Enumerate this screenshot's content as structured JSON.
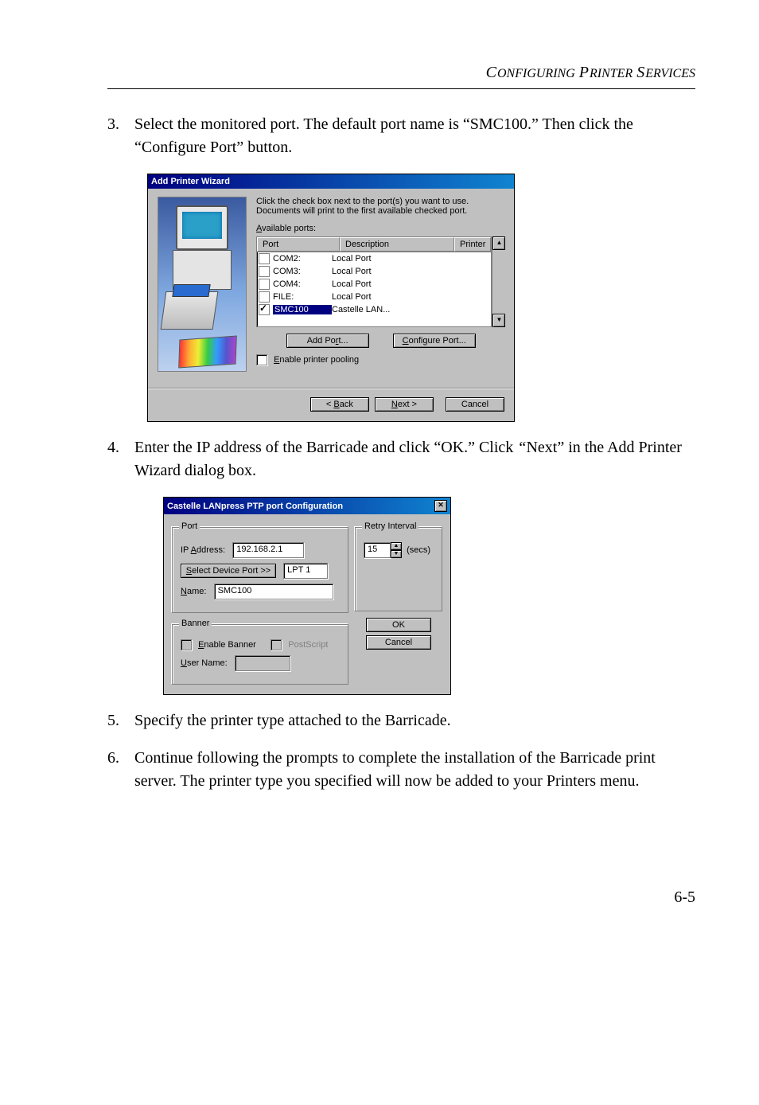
{
  "header": "Configuring Printer Services",
  "steps": {
    "s3": {
      "num": "3.",
      "text": "Select the monitored port. The default port name is “SMC100.” Then click the “Configure Port” button."
    },
    "s4": {
      "num": "4.",
      "text": "Enter the IP address of the Barricade and click “OK.” Click “Next” in the Add Printer Wizard dialog box."
    },
    "s5": {
      "num": "5.",
      "text": "Specify the printer type attached to the Barricade."
    },
    "s6": {
      "num": "6.",
      "text": "Continue following the prompts to complete the installation of the Barricade print server. The printer type you specified will now be added to your Printers menu."
    }
  },
  "wizard": {
    "title": "Add Printer Wizard",
    "instruction1": "Click the check box next to the port(s) you want to use.",
    "instruction2": "Documents will print to the first available checked port.",
    "available_ports_label": "Available ports:",
    "columns": {
      "port": "Port",
      "desc": "Description",
      "printer": "Printer"
    },
    "rows": [
      {
        "name": "COM2:",
        "desc": "Local Port",
        "checked": false,
        "selected": false
      },
      {
        "name": "COM3:",
        "desc": "Local Port",
        "checked": false,
        "selected": false
      },
      {
        "name": "COM4:",
        "desc": "Local Port",
        "checked": false,
        "selected": false
      },
      {
        "name": "FILE:",
        "desc": "Local Port",
        "checked": false,
        "selected": false
      },
      {
        "name": "SMC100",
        "desc": "Castelle LAN...",
        "checked": true,
        "selected": true
      }
    ],
    "add_port": "Add Port...",
    "configure_port": "Configure Port...",
    "enable_pooling": "Enable printer pooling",
    "back": "< Back",
    "next": "Next >",
    "cancel": "Cancel"
  },
  "castelle": {
    "title": "Castelle LANpress PTP port  Configuration",
    "port_legend": "Port",
    "retry_legend": "Retry Interval",
    "ip_label": "IP Address:",
    "ip_value": "192.168.2.1",
    "select_device": "Select Device Port >>",
    "device_value": "LPT 1",
    "name_label": "Name:",
    "name_value": "SMC100",
    "retry_value": "15",
    "retry_unit": "(secs)",
    "banner_legend": "Banner",
    "enable_banner": "Enable Banner",
    "postscript": "PostScript",
    "user_name_label": "User Name:",
    "ok": "OK",
    "cancel": "Cancel"
  },
  "page_number": "6-5"
}
